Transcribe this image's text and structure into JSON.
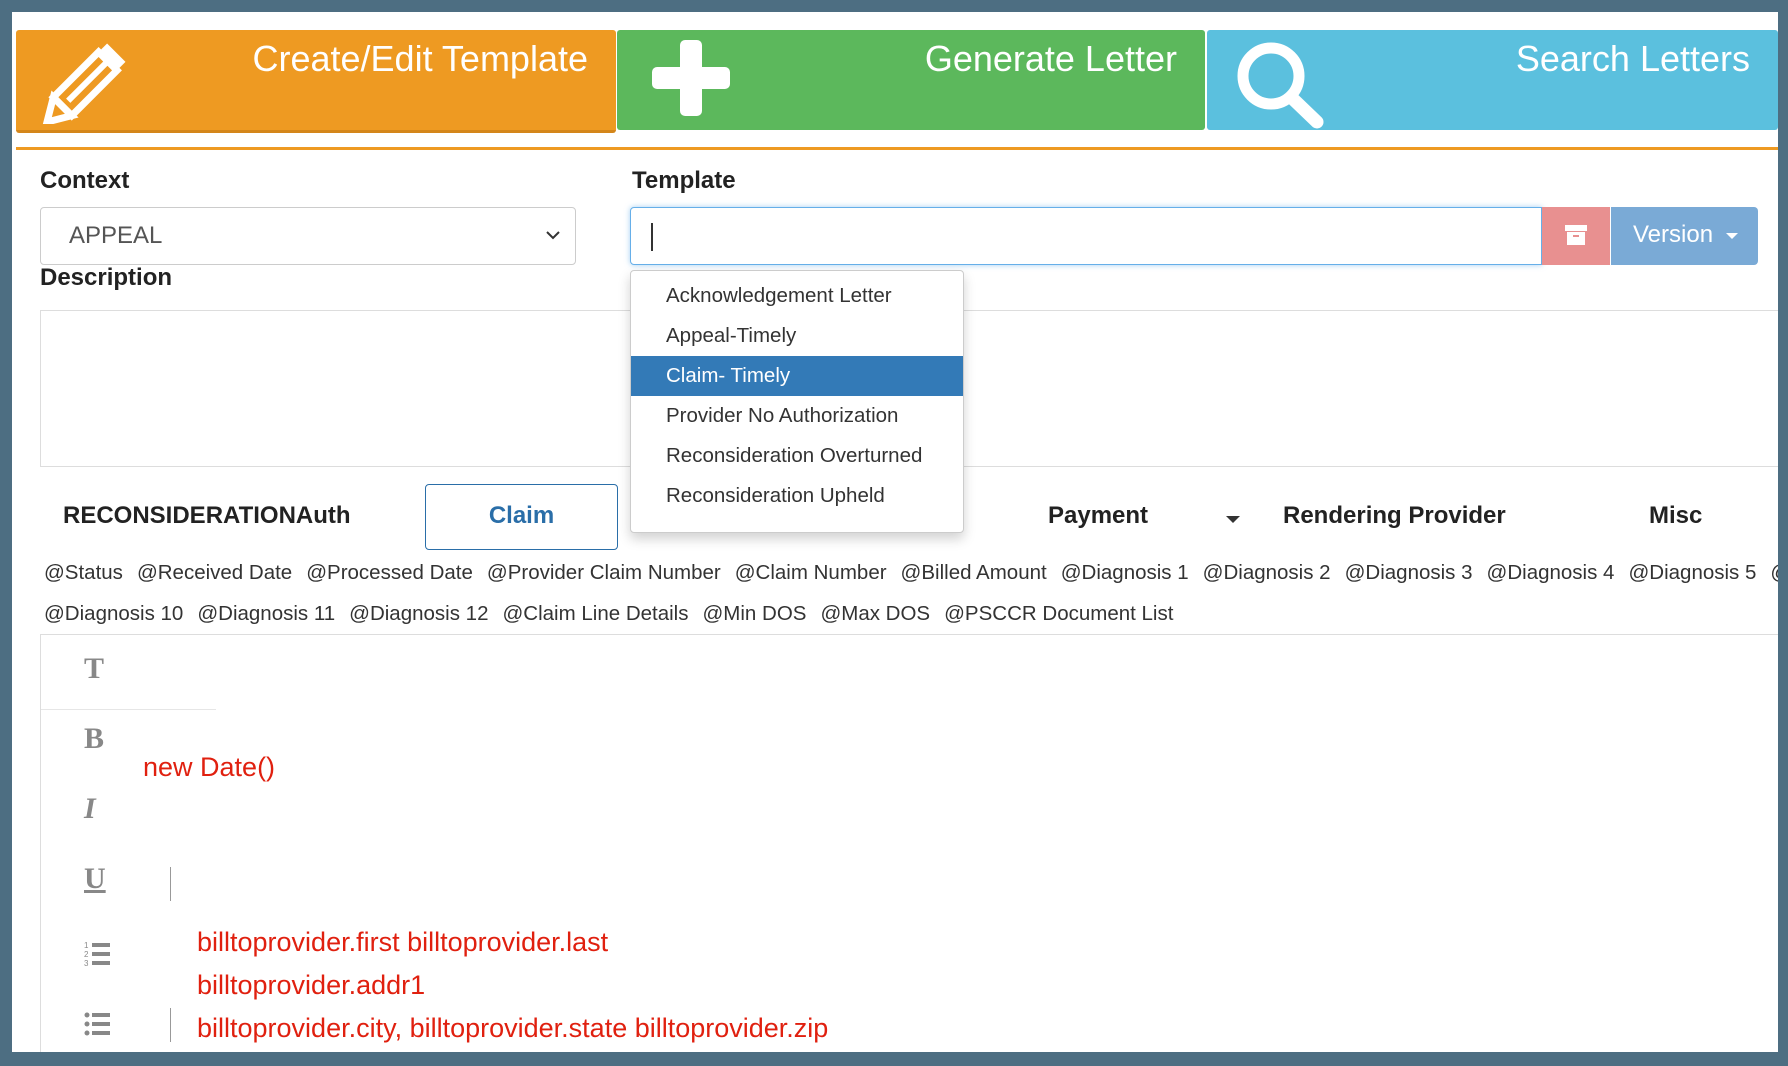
{
  "tiles": {
    "create": {
      "label": "Create/Edit Template",
      "color": "#ee9a22",
      "icon": "pencil-icon"
    },
    "generate": {
      "label": "Generate Letter",
      "color": "#5cb85c",
      "icon": "plus-icon"
    },
    "search": {
      "label": "Search Letters",
      "color": "#5bc0de",
      "icon": "search-icon"
    }
  },
  "form": {
    "context_label": "Context",
    "context_value": "APPEAL",
    "template_label": "Template",
    "template_value": "",
    "version_button": "Version",
    "description_label": "Description"
  },
  "template_dropdown": {
    "items": [
      "Acknowledgement Letter",
      "Appeal-Timely",
      "Claim- Timely",
      "Provider No Authorization",
      "Reconsideration Overturned",
      "Reconsideration Upheld"
    ],
    "selected": "Claim- Timely"
  },
  "tabs": [
    "RECONSIDERATIONAuth",
    "Claim",
    "Payment",
    "Rendering Provider",
    "Misc"
  ],
  "active_tab": "Claim",
  "variables_row1": [
    "@Status",
    "@Received Date",
    "@Processed Date",
    "@Provider Claim Number",
    "@Claim Number",
    "@Billed Amount",
    "@Diagnosis 1",
    "@Diagnosis 2",
    "@Diagnosis 3",
    "@Diagnosis 4",
    "@Diagnosis 5",
    "@"
  ],
  "variables_row2": [
    "@Diagnosis 10",
    "@Diagnosis 11",
    "@Diagnosis 12",
    "@Claim Line Details",
    "@Min DOS",
    "@Max DOS",
    "@PSCCR Document List"
  ],
  "toolbar": [
    "T",
    "B",
    "I",
    "U"
  ],
  "editor": {
    "line1": "new Date()",
    "line2": "billtoprovider.first billtoprovider.last",
    "line3": "billtoprovider.addr1",
    "line4": "billtoprovider.city, billtoprovider.state billtoprovider.zip",
    "text_color": "#e0200f"
  }
}
